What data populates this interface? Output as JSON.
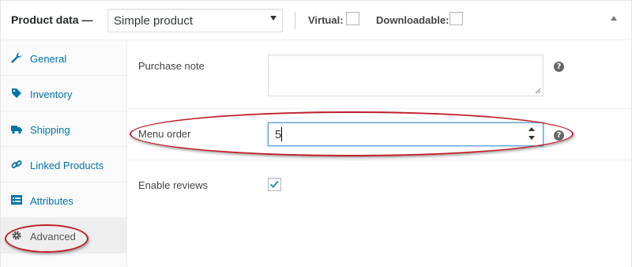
{
  "header": {
    "title": "Product data —",
    "product_type": "Simple product",
    "virtual_label": "Virtual:",
    "downloadable_label": "Downloadable:",
    "virtual_checked": false,
    "downloadable_checked": false
  },
  "sidebar": {
    "items": [
      {
        "label": "General",
        "icon": "wrench-icon",
        "active": false
      },
      {
        "label": "Inventory",
        "icon": "tag-icon",
        "active": false
      },
      {
        "label": "Shipping",
        "icon": "truck-icon",
        "active": false
      },
      {
        "label": "Linked Products",
        "icon": "link-icon",
        "active": false
      },
      {
        "label": "Attributes",
        "icon": "list-icon",
        "active": false
      },
      {
        "label": "Advanced",
        "icon": "gear-icon",
        "active": true
      }
    ]
  },
  "fields": {
    "purchase_note": {
      "label": "Purchase note",
      "value": "",
      "help": "?"
    },
    "menu_order": {
      "label": "Menu order",
      "value": "5",
      "help": "?"
    },
    "enable_reviews": {
      "label": "Enable reviews",
      "checked": true
    }
  },
  "colors": {
    "link": "#0073aa",
    "annotation": "#c0202a",
    "focus_border": "#5b9dd9",
    "check": "#1e8cbe"
  }
}
